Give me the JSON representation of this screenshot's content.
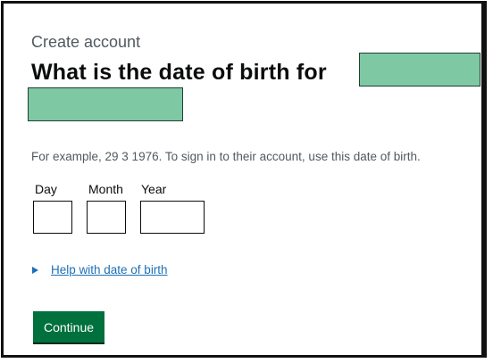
{
  "form": {
    "caption": "Create account",
    "heading": "What is the date of birth for",
    "hint": "For example, 29 3 1976. To sign in to their account, use this date of birth.",
    "fields": {
      "day": {
        "label": "Day",
        "value": ""
      },
      "month": {
        "label": "Month",
        "value": ""
      },
      "year": {
        "label": "Year",
        "value": ""
      }
    },
    "help_link": "Help with date of birth",
    "continue_label": "Continue"
  },
  "colors": {
    "button": "#00703c",
    "link": "#1d70b8",
    "redaction": "#7fc8a4",
    "hint_text": "#505a5f"
  },
  "icons": {
    "details_toggle": "triangle-right-icon"
  }
}
